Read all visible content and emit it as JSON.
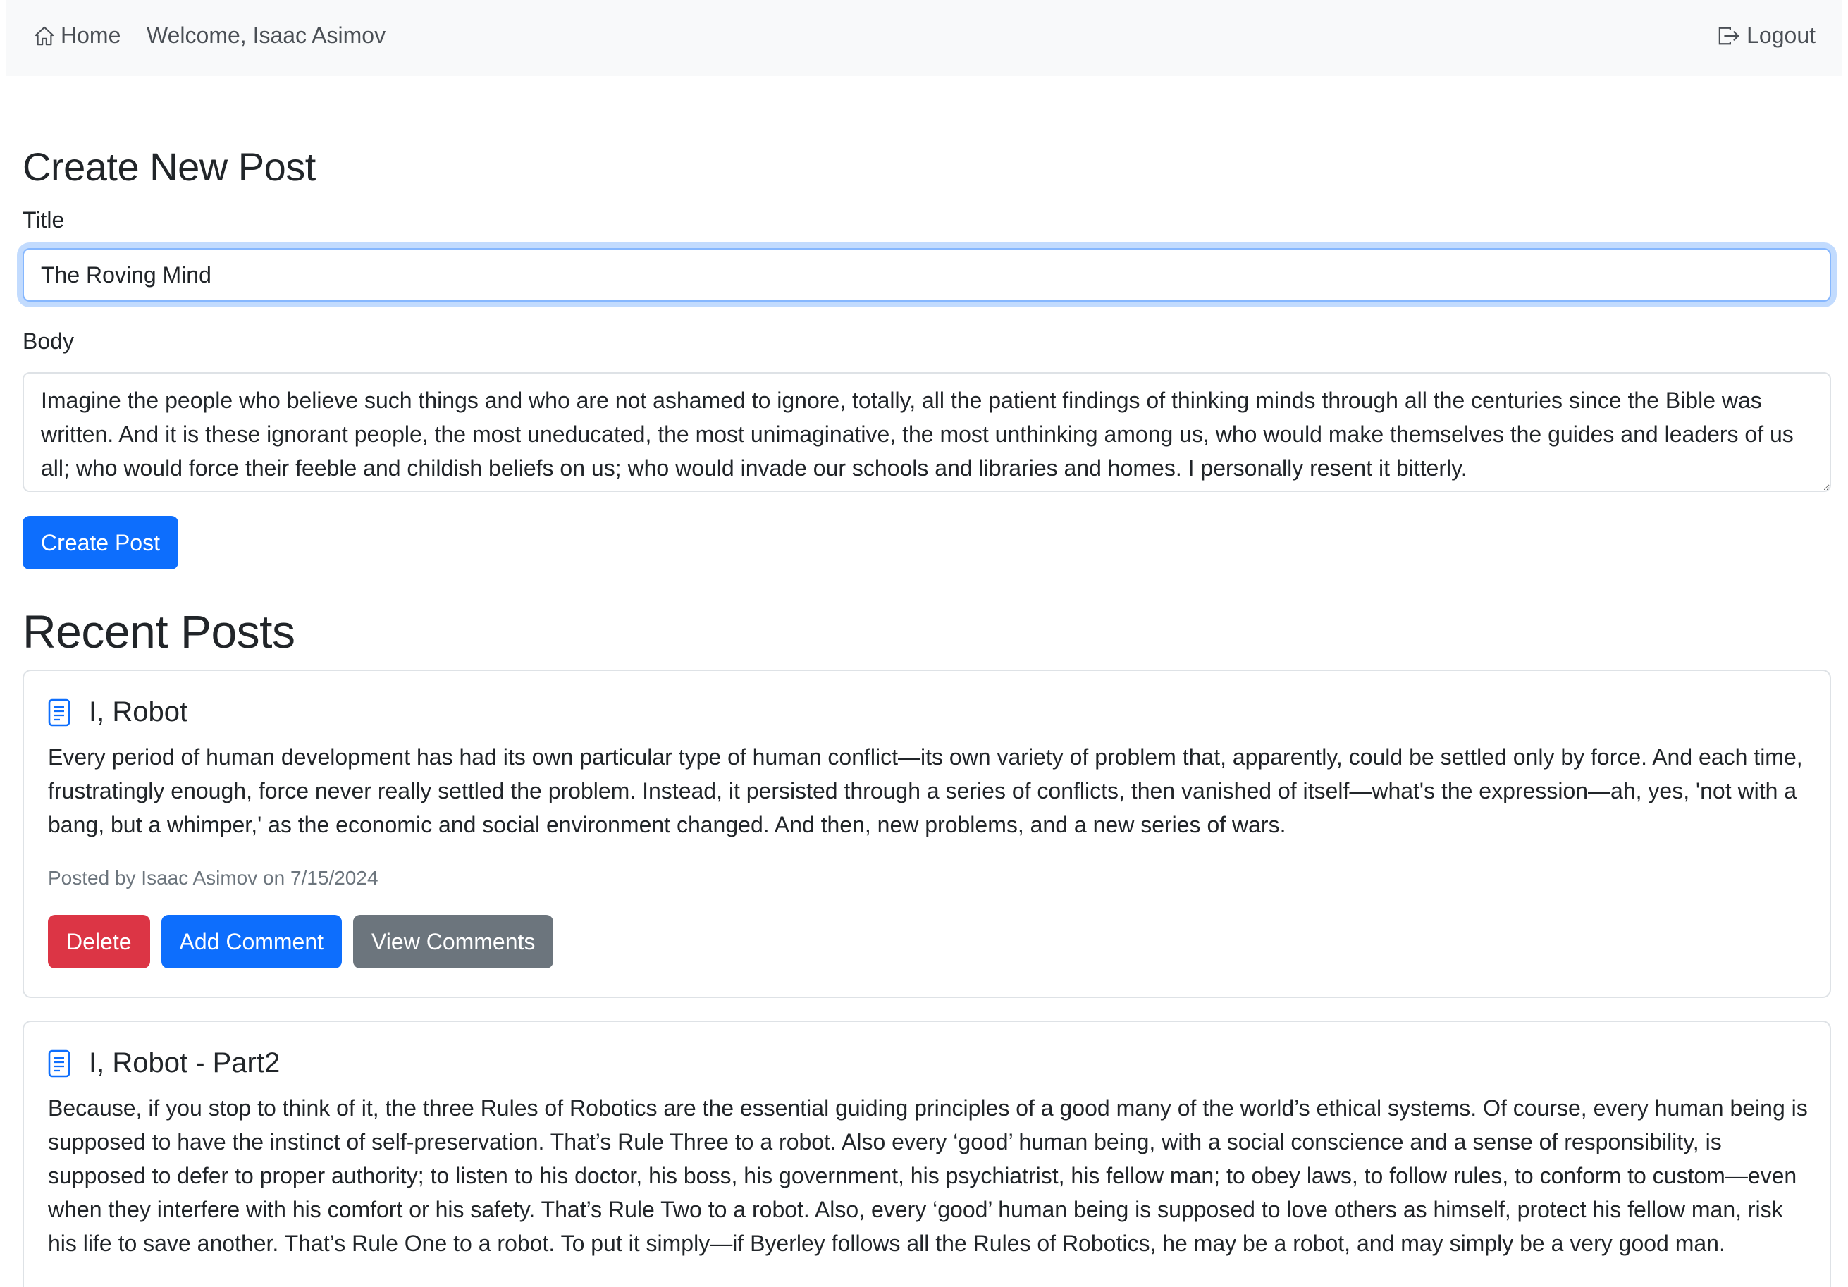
{
  "navbar": {
    "home_label": "Home",
    "welcome_text": "Welcome, Isaac Asimov",
    "logout_label": "Logout"
  },
  "create_form": {
    "heading": "Create New Post",
    "title_label": "Title",
    "title_value": "The Roving Mind",
    "body_label": "Body",
    "body_value": "Imagine the people who believe such things and who are not ashamed to ignore, totally, all the patient findings of thinking minds through all the centuries since the Bible was written. And it is these ignorant people, the most uneducated, the most unimaginative, the most unthinking among us, who would make themselves the guides and leaders of us all; who would force their feeble and childish beliefs on us; who would invade our schools and libraries and homes. I personally resent it bitterly.",
    "submit_label": "Create Post"
  },
  "recent_posts": {
    "heading": "Recent Posts",
    "posts": [
      {
        "title": "I, Robot",
        "body": "Every period of human development has had its own particular type of human conflict—its own variety of problem that, apparently, could be settled only by force. And each time, frustratingly enough, force never really settled the problem. Instead, it persisted through a series of conflicts, then vanished of itself—what's the expression—ah, yes, 'not with a bang, but a whimper,' as the economic and social environment changed. And then, new problems, and a new series of wars.",
        "meta": "Posted by Isaac Asimov on 7/15/2024",
        "delete_label": "Delete",
        "add_comment_label": "Add Comment",
        "view_comments_label": "View Comments"
      },
      {
        "title": "I, Robot - Part2",
        "body": "Because, if you stop to think of it, the three Rules of Robotics are the essential guiding principles of a good many of the world’s ethical systems. Of course, every human being is supposed to have the instinct of self-preservation. That’s Rule Three to a robot. Also every ‘good’ human being, with a social conscience and a sense of responsibility, is supposed to defer to proper authority; to listen to his doctor, his boss, his government, his psychiatrist, his fellow man; to obey laws, to follow rules, to conform to custom—even when they interfere with his comfort or his safety. That’s Rule Two to a robot. Also, every ‘good’ human being is supposed to love others as himself, protect his fellow man, risk his life to save another. That’s Rule One to a robot. To put it simply—if Byerley follows all the Rules of Robotics, he may be a robot, and may simply be a very good man."
      }
    ]
  },
  "icons": {
    "home": "house-icon",
    "logout": "logout-icon",
    "post": "document-icon"
  },
  "colors": {
    "primary": "#0d6efd",
    "danger": "#dc3545",
    "secondary": "#6c757d",
    "navbar_bg": "#f8f9fa"
  }
}
